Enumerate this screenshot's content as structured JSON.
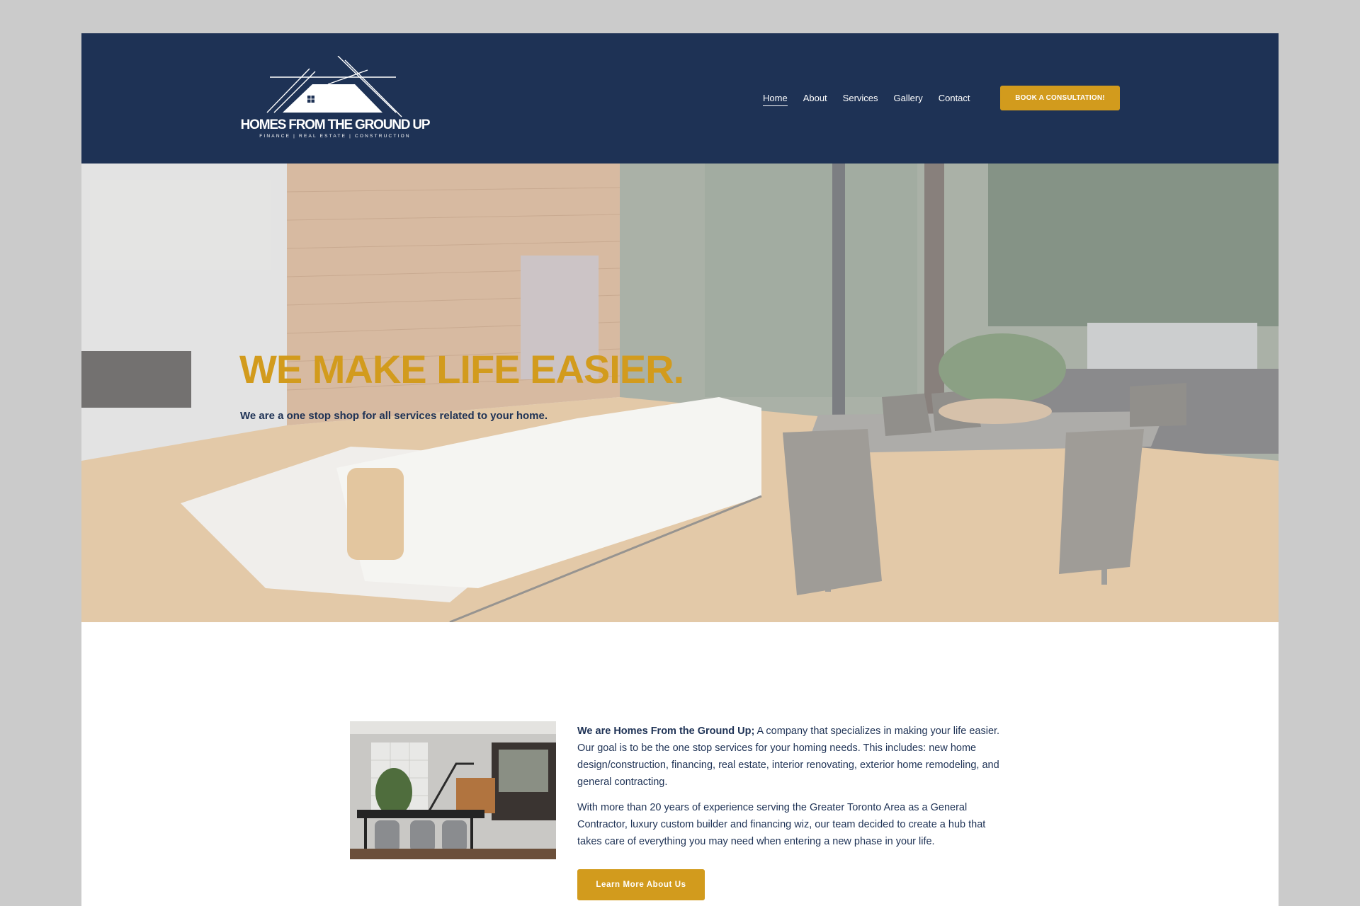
{
  "brand": {
    "name": "HOMES FROM THE GROUND UP",
    "tagline": "FINANCE   |   REAL ESTATE   |   CONSTRUCTION"
  },
  "nav": {
    "items": [
      {
        "label": "Home",
        "active": true
      },
      {
        "label": "About"
      },
      {
        "label": "Services"
      },
      {
        "label": "Gallery"
      },
      {
        "label": "Contact"
      }
    ],
    "cta_label": "BOOK A CONSULTATION!"
  },
  "hero": {
    "title": "WE MAKE LIFE EASIER.",
    "subtitle": "We are a one stop shop for all services related to your home."
  },
  "about": {
    "intro_bold": "We are Homes From the Ground Up;",
    "intro_rest": " A company that specializes in making your life easier. Our goal is to be the one stop services for your homing needs. This includes: new home design/construction, financing, real estate, interior renovating, exterior home remodeling, and general contracting.",
    "paragraph_2": "With more than 20 years of experience serving the Greater Toronto Area as a General Contractor, luxury custom builder and financing wiz, our team decided to create a hub that takes care of everything you may need when entering a new phase in your life.",
    "button_label": "Learn More About Us"
  },
  "colors": {
    "navy": "#1e3255",
    "gold": "#d29b1d",
    "page_bg": "#cbcbcb"
  }
}
